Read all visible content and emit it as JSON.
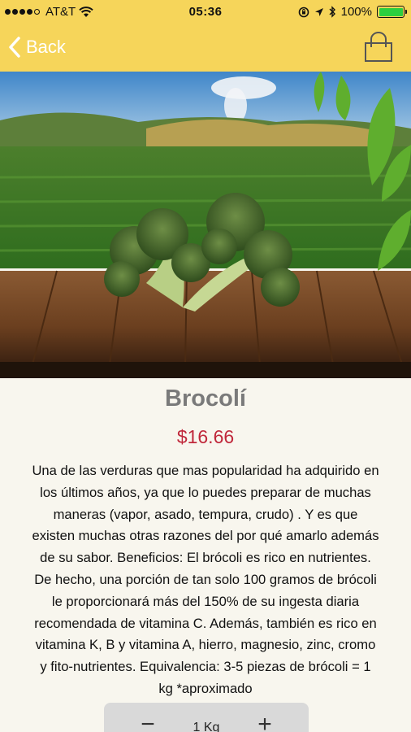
{
  "status_bar": {
    "carrier": "AT&T",
    "time": "05:36",
    "battery": "100%",
    "signal_bars": 4
  },
  "nav": {
    "back_label": "Back",
    "back_icon": "chevron-left-icon",
    "cart_icon": "shopping-bag-icon"
  },
  "product": {
    "name": "Brocolí",
    "price": "$16.66",
    "description_lines": [
      "Una de las verduras que mas popularidad ha adquirido en",
      "los últimos años, ya que lo puedes preparar de muchas",
      "maneras (vapor, asado, tempura, crudo) . Y es que",
      "existen muchas otras razones del por qué amarlo además",
      "de su sabor. Beneficios: El brócoli es rico en nutrientes.",
      "De hecho, una porción de tan solo 100 gramos de brócoli",
      "le proporcionará más del 150% de su ingesta diaria",
      "recomendada de vitamina C. Además, también es rico en",
      "vitamina K, B y vitamina A, hierro, magnesio, zinc, cromo",
      "y fito-nutrientes. Equivalencia: 3-5 piezas de brócoli = 1",
      "kg *aproximado"
    ]
  },
  "quantity": {
    "minus_label": "−",
    "value": "1 Kg",
    "plus_label": "+"
  },
  "colors": {
    "nav_bg": "#f6d55a",
    "price": "#c0283b",
    "name": "#7a7a7a",
    "page_bg": "#f8f6ee"
  }
}
